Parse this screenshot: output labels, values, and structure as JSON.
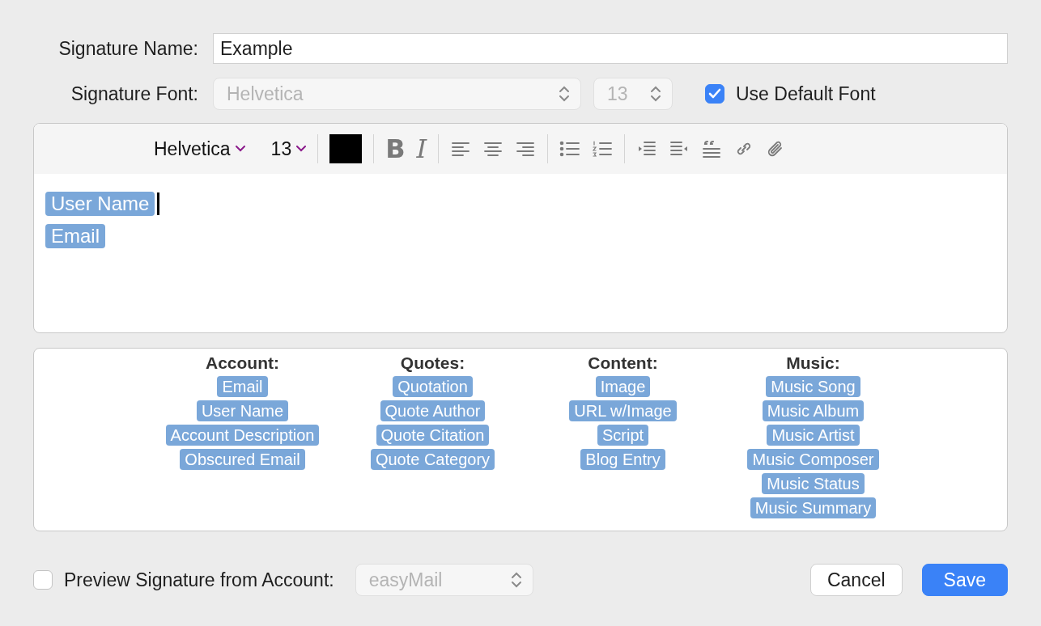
{
  "signature_name": {
    "label": "Signature Name:",
    "value": "Example"
  },
  "signature_font": {
    "label": "Signature Font:",
    "font": "Helvetica",
    "size": "13",
    "disabled": true
  },
  "use_default_font": {
    "label": "Use Default Font",
    "checked": true
  },
  "toolbar": {
    "font": "Helvetica",
    "size": "13",
    "color": "#000000",
    "bold": "B",
    "italic": "I"
  },
  "editor": {
    "lines": [
      {
        "token": "User Name",
        "cursor": true
      },
      {
        "token": "Email",
        "cursor": false
      }
    ]
  },
  "placeholders": [
    {
      "title": "Account:",
      "items": [
        "Email",
        "User Name",
        "Account Description",
        "Obscured Email"
      ]
    },
    {
      "title": "Quotes:",
      "items": [
        "Quotation",
        "Quote Author",
        "Quote Citation",
        "Quote Category"
      ]
    },
    {
      "title": "Content:",
      "items": [
        "Image",
        "URL w/Image",
        "Script",
        "Blog Entry"
      ]
    },
    {
      "title": "Music:",
      "items": [
        "Music Song",
        "Music Album",
        "Music Artist",
        "Music Composer",
        "Music Status",
        "Music Summary"
      ]
    }
  ],
  "preview": {
    "label": "Preview Signature from Account:",
    "checked": false,
    "account": "easyMail",
    "disabled": true
  },
  "buttons": [
    {
      "label": "Cancel",
      "kind": "default"
    },
    {
      "label": "Save",
      "kind": "primary"
    }
  ]
}
